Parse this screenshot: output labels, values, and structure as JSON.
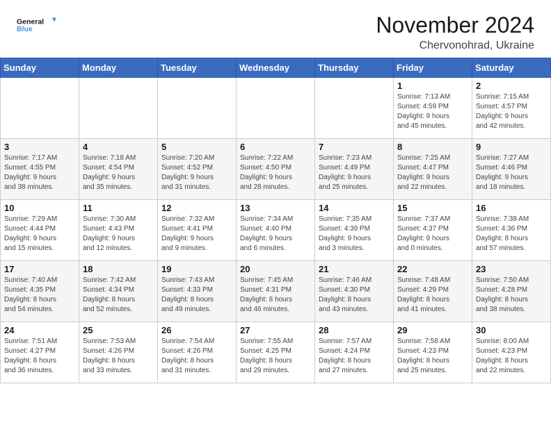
{
  "header": {
    "logo_line1": "General",
    "logo_line2": "Blue",
    "month": "November 2024",
    "location": "Chervonohrad, Ukraine"
  },
  "weekdays": [
    "Sunday",
    "Monday",
    "Tuesday",
    "Wednesday",
    "Thursday",
    "Friday",
    "Saturday"
  ],
  "weeks": [
    [
      {
        "day": "",
        "info": ""
      },
      {
        "day": "",
        "info": ""
      },
      {
        "day": "",
        "info": ""
      },
      {
        "day": "",
        "info": ""
      },
      {
        "day": "",
        "info": ""
      },
      {
        "day": "1",
        "info": "Sunrise: 7:13 AM\nSunset: 4:59 PM\nDaylight: 9 hours\nand 45 minutes."
      },
      {
        "day": "2",
        "info": "Sunrise: 7:15 AM\nSunset: 4:57 PM\nDaylight: 9 hours\nand 42 minutes."
      }
    ],
    [
      {
        "day": "3",
        "info": "Sunrise: 7:17 AM\nSunset: 4:55 PM\nDaylight: 9 hours\nand 38 minutes."
      },
      {
        "day": "4",
        "info": "Sunrise: 7:18 AM\nSunset: 4:54 PM\nDaylight: 9 hours\nand 35 minutes."
      },
      {
        "day": "5",
        "info": "Sunrise: 7:20 AM\nSunset: 4:52 PM\nDaylight: 9 hours\nand 31 minutes."
      },
      {
        "day": "6",
        "info": "Sunrise: 7:22 AM\nSunset: 4:50 PM\nDaylight: 9 hours\nand 28 minutes."
      },
      {
        "day": "7",
        "info": "Sunrise: 7:23 AM\nSunset: 4:49 PM\nDaylight: 9 hours\nand 25 minutes."
      },
      {
        "day": "8",
        "info": "Sunrise: 7:25 AM\nSunset: 4:47 PM\nDaylight: 9 hours\nand 22 minutes."
      },
      {
        "day": "9",
        "info": "Sunrise: 7:27 AM\nSunset: 4:46 PM\nDaylight: 9 hours\nand 18 minutes."
      }
    ],
    [
      {
        "day": "10",
        "info": "Sunrise: 7:29 AM\nSunset: 4:44 PM\nDaylight: 9 hours\nand 15 minutes."
      },
      {
        "day": "11",
        "info": "Sunrise: 7:30 AM\nSunset: 4:43 PM\nDaylight: 9 hours\nand 12 minutes."
      },
      {
        "day": "12",
        "info": "Sunrise: 7:32 AM\nSunset: 4:41 PM\nDaylight: 9 hours\nand 9 minutes."
      },
      {
        "day": "13",
        "info": "Sunrise: 7:34 AM\nSunset: 4:40 PM\nDaylight: 9 hours\nand 6 minutes."
      },
      {
        "day": "14",
        "info": "Sunrise: 7:35 AM\nSunset: 4:39 PM\nDaylight: 9 hours\nand 3 minutes."
      },
      {
        "day": "15",
        "info": "Sunrise: 7:37 AM\nSunset: 4:37 PM\nDaylight: 9 hours\nand 0 minutes."
      },
      {
        "day": "16",
        "info": "Sunrise: 7:38 AM\nSunset: 4:36 PM\nDaylight: 8 hours\nand 57 minutes."
      }
    ],
    [
      {
        "day": "17",
        "info": "Sunrise: 7:40 AM\nSunset: 4:35 PM\nDaylight: 8 hours\nand 54 minutes."
      },
      {
        "day": "18",
        "info": "Sunrise: 7:42 AM\nSunset: 4:34 PM\nDaylight: 8 hours\nand 52 minutes."
      },
      {
        "day": "19",
        "info": "Sunrise: 7:43 AM\nSunset: 4:33 PM\nDaylight: 8 hours\nand 49 minutes."
      },
      {
        "day": "20",
        "info": "Sunrise: 7:45 AM\nSunset: 4:31 PM\nDaylight: 8 hours\nand 46 minutes."
      },
      {
        "day": "21",
        "info": "Sunrise: 7:46 AM\nSunset: 4:30 PM\nDaylight: 8 hours\nand 43 minutes."
      },
      {
        "day": "22",
        "info": "Sunrise: 7:48 AM\nSunset: 4:29 PM\nDaylight: 8 hours\nand 41 minutes."
      },
      {
        "day": "23",
        "info": "Sunrise: 7:50 AM\nSunset: 4:28 PM\nDaylight: 8 hours\nand 38 minutes."
      }
    ],
    [
      {
        "day": "24",
        "info": "Sunrise: 7:51 AM\nSunset: 4:27 PM\nDaylight: 8 hours\nand 36 minutes."
      },
      {
        "day": "25",
        "info": "Sunrise: 7:53 AM\nSunset: 4:26 PM\nDaylight: 8 hours\nand 33 minutes."
      },
      {
        "day": "26",
        "info": "Sunrise: 7:54 AM\nSunset: 4:26 PM\nDaylight: 8 hours\nand 31 minutes."
      },
      {
        "day": "27",
        "info": "Sunrise: 7:55 AM\nSunset: 4:25 PM\nDaylight: 8 hours\nand 29 minutes."
      },
      {
        "day": "28",
        "info": "Sunrise: 7:57 AM\nSunset: 4:24 PM\nDaylight: 8 hours\nand 27 minutes."
      },
      {
        "day": "29",
        "info": "Sunrise: 7:58 AM\nSunset: 4:23 PM\nDaylight: 8 hours\nand 25 minutes."
      },
      {
        "day": "30",
        "info": "Sunrise: 8:00 AM\nSunset: 4:23 PM\nDaylight: 8 hours\nand 22 minutes."
      }
    ]
  ]
}
